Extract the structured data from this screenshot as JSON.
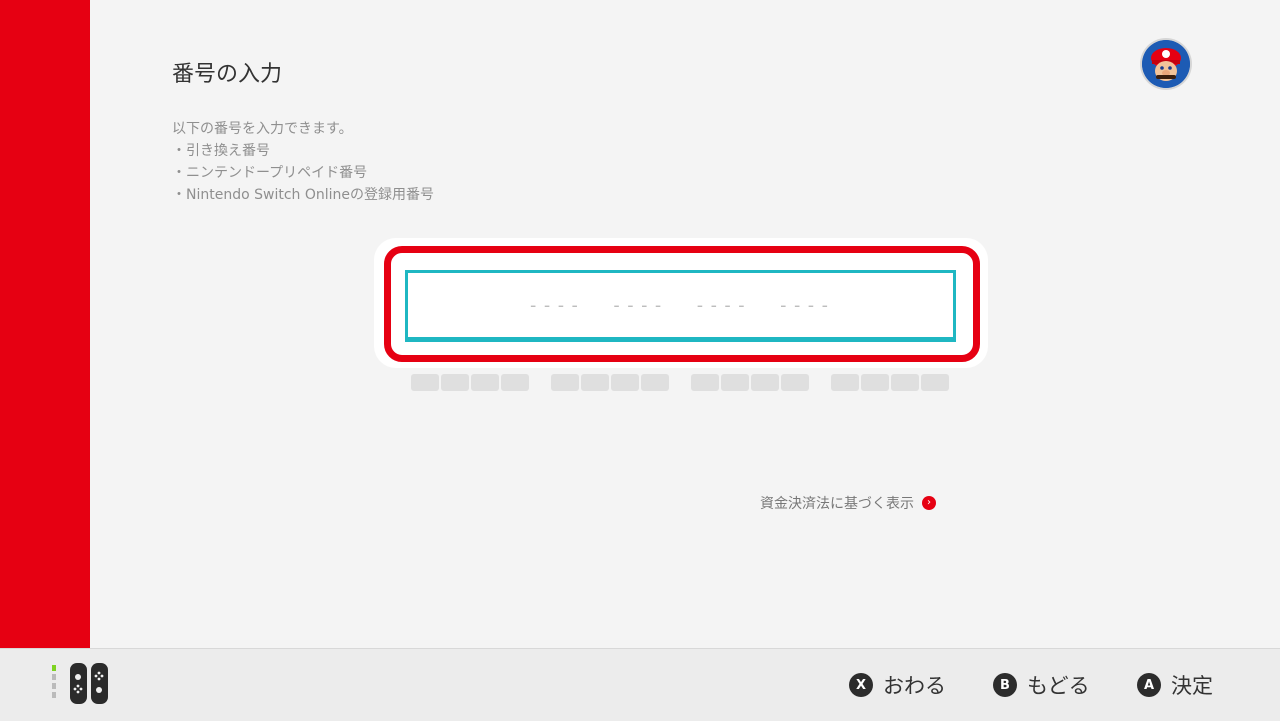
{
  "page": {
    "title": "番号の入力",
    "description": [
      "以下の番号を入力できます。",
      "・引き換え番号",
      "・ニンテンドープリペイド番号",
      "・Nintendo Switch Onlineの登録用番号"
    ]
  },
  "code_input": {
    "groups": [
      "----",
      "----",
      "----",
      "----"
    ],
    "accent_color": "#1fb7c2",
    "focus_color": "#e60012"
  },
  "legal": {
    "link_label": "資金決済法に基づく表示",
    "arrow_glyph": "›"
  },
  "footer": {
    "controller_icon": "joycon-pair-icon",
    "hints": [
      {
        "button": "X",
        "label": "おわる"
      },
      {
        "button": "B",
        "label": "もどる"
      },
      {
        "button": "A",
        "label": "決定"
      }
    ]
  },
  "user": {
    "avatar_icon": "mario-avatar-icon"
  },
  "colors": {
    "brand_red": "#e60012",
    "background": "#f4f4f4"
  }
}
